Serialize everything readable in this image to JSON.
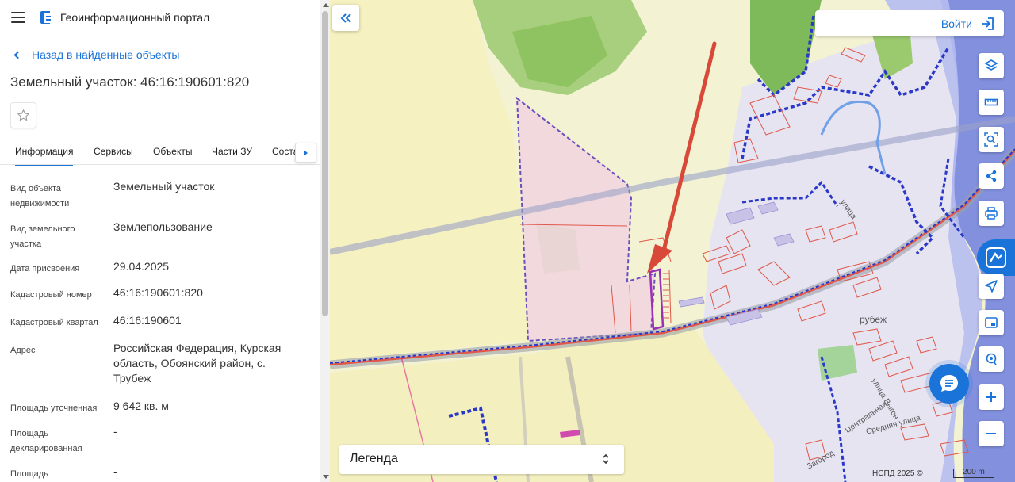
{
  "header": {
    "app_title": "Геоинформационный портал"
  },
  "back_link": "Назад в найденные объекты",
  "page_title": "Земельный участок: 46:16:190601:820",
  "tabs": [
    {
      "label": "Информация",
      "active": true
    },
    {
      "label": "Сервисы",
      "active": false
    },
    {
      "label": "Объекты",
      "active": false
    },
    {
      "label": "Части ЗУ",
      "active": false
    },
    {
      "label": "Соста",
      "active": false
    }
  ],
  "info": [
    {
      "label": "Вид объекта недвижимости",
      "value": "Земельный участок"
    },
    {
      "label": "Вид земельного участка",
      "value": "Землепользование"
    },
    {
      "label": "Дата присвоения",
      "value": "29.04.2025"
    },
    {
      "label": "Кадастровый номер",
      "value": "46:16:190601:820"
    },
    {
      "label": "Кадастровый квартал",
      "value": "46:16:190601"
    },
    {
      "label": "Адрес",
      "value": "Российская Федерация, Курская область, Обоянский район, с. Трубеж"
    },
    {
      "label": "Площадь уточненная",
      "value": "9 642 кв. м"
    },
    {
      "label": "Площадь декларированная",
      "value": "-"
    },
    {
      "label": "Площадь",
      "value": "-"
    }
  ],
  "map": {
    "login_label": "Войти",
    "legend_title": "Легенда",
    "attribution": "НСПД 2025 ©",
    "scale_label": "200 m",
    "labels": {
      "village": "рубеж",
      "street_1": "улица",
      "street_2": "улица Выгон",
      "street_3": "Центральная",
      "street_4": "Средняя улица",
      "street_5": "Загород"
    }
  },
  "colors": {
    "accent": "#1a73d9",
    "parcel_border": "#e0584a",
    "selected_parcel": "#9b2fb5",
    "boundary": "#2b39c9",
    "arrow": "#d9493a"
  },
  "icons": {
    "menu": "hamburger-icon",
    "logo": "portal-logo-icon",
    "back": "chevron-left-icon",
    "favorite": "star-icon",
    "collapse": "double-chevron-left-icon",
    "login": "sign-in-icon",
    "tools": [
      "layers-icon",
      "ruler-icon",
      "search-area-icon",
      "share-icon",
      "print-icon",
      "navigate-icon",
      "picture-in-picture-icon",
      "geolocation-icon"
    ],
    "chat": "chat-icon"
  }
}
